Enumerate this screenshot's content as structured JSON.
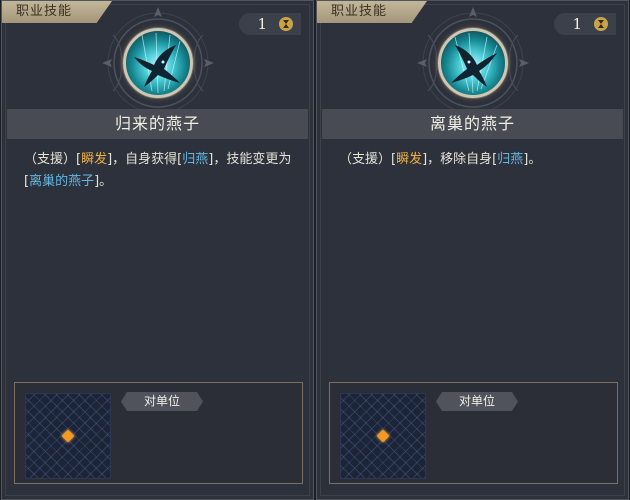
{
  "cards": [
    {
      "tag": "职业技能",
      "cost": "1",
      "cost_icon": "hourglass-icon",
      "skill_icon": "swallow-icon",
      "title": "归来的燕子",
      "description": [
        {
          "text": "（支援）[",
          "style": "plain"
        },
        {
          "text": "瞬发",
          "style": "orange"
        },
        {
          "text": "]，自身获得[",
          "style": "plain"
        },
        {
          "text": "归燕",
          "style": "blue"
        },
        {
          "text": "]，技能变更为[",
          "style": "plain"
        },
        {
          "text": "离巢的燕子",
          "style": "blue"
        },
        {
          "text": "]。",
          "style": "plain"
        }
      ],
      "target_label": "对单位"
    },
    {
      "tag": "职业技能",
      "cost": "1",
      "cost_icon": "hourglass-icon",
      "skill_icon": "swallow-icon",
      "title": "离巢的燕子",
      "description": [
        {
          "text": "（支援）[",
          "style": "plain"
        },
        {
          "text": "瞬发",
          "style": "orange"
        },
        {
          "text": "]，移除自身[",
          "style": "plain"
        },
        {
          "text": "归燕",
          "style": "blue"
        },
        {
          "text": "]。",
          "style": "plain"
        }
      ],
      "target_label": "对单位"
    }
  ],
  "colors": {
    "keyword_orange": "#f0b143",
    "keyword_blue": "#62b7e3",
    "tag_gold": "#b5a98c",
    "panel_bg": "#2d313b",
    "target_marker": "#f59a20"
  }
}
